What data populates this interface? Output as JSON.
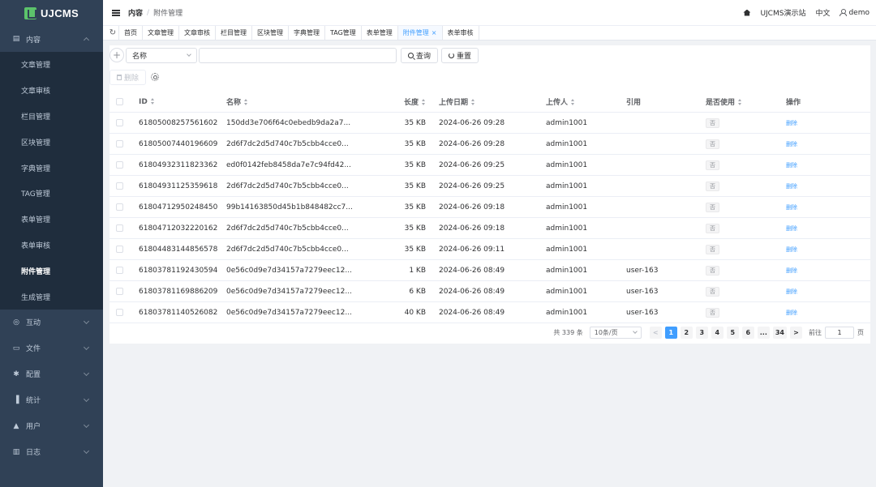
{
  "brand": {
    "logo_text": "UJCMS"
  },
  "sidebar": {
    "groups": [
      {
        "label": "内容",
        "icon": "document-icon",
        "expanded": true,
        "items": [
          "文章管理",
          "文章审核",
          "栏目管理",
          "区块管理",
          "字典管理",
          "TAG管理",
          "表单管理",
          "表单审核",
          "附件管理",
          "生成管理"
        ],
        "active_item": "附件管理"
      },
      {
        "label": "互动",
        "icon": "chat-icon"
      },
      {
        "label": "文件",
        "icon": "folder-icon"
      },
      {
        "label": "配置",
        "icon": "gear-icon"
      },
      {
        "label": "统计",
        "icon": "bar-chart-icon"
      },
      {
        "label": "用户",
        "icon": "user-icon"
      },
      {
        "label": "日志",
        "icon": "log-icon"
      }
    ]
  },
  "header": {
    "breadcrumb": [
      "内容",
      "附件管理"
    ],
    "site_name": "UJCMS演示站",
    "language": "中文",
    "username": "demo"
  },
  "tabs": [
    {
      "label": "首页"
    },
    {
      "label": "文章管理"
    },
    {
      "label": "文章审核"
    },
    {
      "label": "栏目管理"
    },
    {
      "label": "区块管理"
    },
    {
      "label": "字典管理"
    },
    {
      "label": "TAG管理"
    },
    {
      "label": "表单管理"
    },
    {
      "label": "附件管理",
      "active": true,
      "closable": true
    },
    {
      "label": "表单审核"
    }
  ],
  "search": {
    "field_value": "名称",
    "input_value": "",
    "query_label": "查询",
    "reset_label": "重置"
  },
  "toolbar": {
    "delete_label": "删除"
  },
  "table": {
    "columns": [
      "ID",
      "名称",
      "长度",
      "上传日期",
      "上传人",
      "引用",
      "是否使用",
      "操作"
    ],
    "rows": [
      {
        "id": "61805008257561602",
        "name": "150dd3e706f64c0ebedb9da2a7...",
        "length": "35 KB",
        "date": "2024-06-26 09:28",
        "user": "admin1001",
        "ref": "",
        "used": "否",
        "op": "删除"
      },
      {
        "id": "61805007440196609",
        "name": "2d6f7dc2d5d740c7b5cbb4cce0...",
        "length": "35 KB",
        "date": "2024-06-26 09:28",
        "user": "admin1001",
        "ref": "",
        "used": "否",
        "op": "删除"
      },
      {
        "id": "61804932311823362",
        "name": "ed0f0142feb8458da7e7c94fd42...",
        "length": "35 KB",
        "date": "2024-06-26 09:25",
        "user": "admin1001",
        "ref": "",
        "used": "否",
        "op": "删除"
      },
      {
        "id": "61804931125359618",
        "name": "2d6f7dc2d5d740c7b5cbb4cce0...",
        "length": "35 KB",
        "date": "2024-06-26 09:25",
        "user": "admin1001",
        "ref": "",
        "used": "否",
        "op": "删除"
      },
      {
        "id": "61804712950248450",
        "name": "99b14163850d45b1b848482cc7...",
        "length": "35 KB",
        "date": "2024-06-26 09:18",
        "user": "admin1001",
        "ref": "",
        "used": "否",
        "op": "删除"
      },
      {
        "id": "61804712032220162",
        "name": "2d6f7dc2d5d740c7b5cbb4cce0...",
        "length": "35 KB",
        "date": "2024-06-26 09:18",
        "user": "admin1001",
        "ref": "",
        "used": "否",
        "op": "删除"
      },
      {
        "id": "61804483144856578",
        "name": "2d6f7dc2d5d740c7b5cbb4cce0...",
        "length": "35 KB",
        "date": "2024-06-26 09:11",
        "user": "admin1001",
        "ref": "",
        "used": "否",
        "op": "删除"
      },
      {
        "id": "61803781192430594",
        "name": "0e56c0d9e7d34157a7279eec12...",
        "length": "1 KB",
        "date": "2024-06-26 08:49",
        "user": "admin1001",
        "ref": "user-163",
        "used": "否",
        "op": "删除"
      },
      {
        "id": "61803781169886209",
        "name": "0e56c0d9e7d34157a7279eec12...",
        "length": "6 KB",
        "date": "2024-06-26 08:49",
        "user": "admin1001",
        "ref": "user-163",
        "used": "否",
        "op": "删除"
      },
      {
        "id": "61803781140526082",
        "name": "0e56c0d9e7d34157a7279eec12...",
        "length": "40 KB",
        "date": "2024-06-26 08:49",
        "user": "admin1001",
        "ref": "user-163",
        "used": "否",
        "op": "删除"
      }
    ]
  },
  "pagination": {
    "total_text": "共 339 条",
    "page_size": "10条/页",
    "prev": "<",
    "next": ">",
    "pages": [
      "1",
      "2",
      "3",
      "4",
      "5",
      "6",
      "...",
      "34"
    ],
    "current": "1",
    "goto_label": "前往",
    "goto_value": "1",
    "page_unit": "页"
  },
  "colors": {
    "sidebar_bg": "#304156",
    "submenu_bg": "#1f2d3d",
    "accent": "#409eff",
    "logo_green": "#5cc36b"
  }
}
